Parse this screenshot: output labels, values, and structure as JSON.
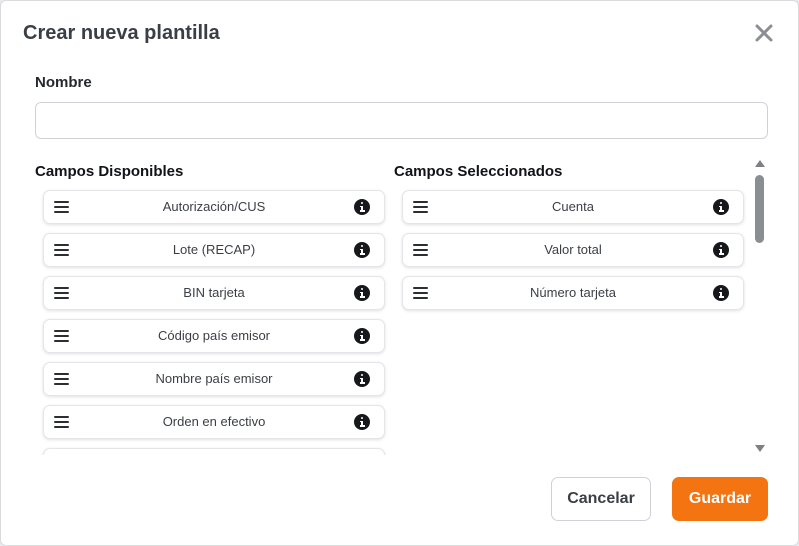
{
  "dialog": {
    "title": "Crear nueva plantilla",
    "close_label": "×"
  },
  "name_field": {
    "label": "Nombre",
    "value": "",
    "placeholder": ""
  },
  "available": {
    "title": "Campos Disponibles",
    "items": [
      {
        "label": "Autorización/CUS"
      },
      {
        "label": "Lote (RECAP)"
      },
      {
        "label": "BIN tarjeta"
      },
      {
        "label": "Código país emisor"
      },
      {
        "label": "Nombre país emisor"
      },
      {
        "label": "Orden en efectivo"
      },
      {
        "label": ""
      }
    ]
  },
  "selected": {
    "title": "Campos Seleccionados",
    "items": [
      {
        "label": "Cuenta"
      },
      {
        "label": "Valor total"
      },
      {
        "label": "Número tarjeta"
      }
    ]
  },
  "actions": {
    "cancel_label": "Cancelar",
    "save_label": "Guardar"
  },
  "colors": {
    "accent": "#f57412",
    "title_text": "#3a3f46",
    "icon_dark": "#16181b"
  },
  "icons": {
    "close": "close-icon",
    "drag": "drag-handle-icon",
    "info": "info-icon",
    "scroll_up": "arrow-up-icon",
    "scroll_down": "arrow-down-icon"
  }
}
